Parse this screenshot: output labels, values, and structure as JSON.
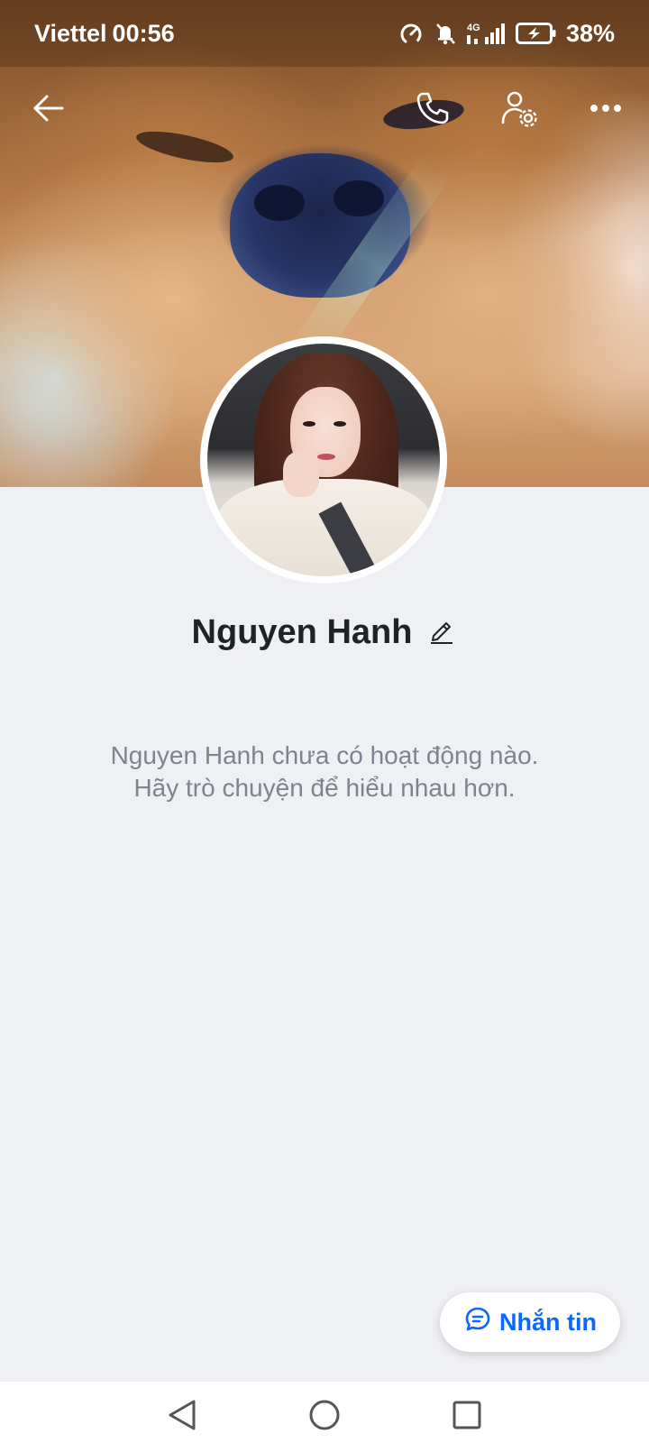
{
  "status_bar": {
    "carrier": "Viettel",
    "time": "00:56",
    "network": "4G",
    "battery": "38%"
  },
  "profile": {
    "name": "Nguyen Hanh",
    "empty_line1": "Nguyen Hanh chưa có hoạt động nào.",
    "empty_line2": "Hãy trò chuyện để hiểu nhau hơn."
  },
  "actions": {
    "message_label": "Nhắn tin"
  },
  "icons": {
    "back": "back-arrow-icon",
    "call": "phone-icon",
    "settings": "user-settings-icon",
    "more": "more-dots-icon",
    "edit": "pencil-icon",
    "message": "chat-bubble-icon"
  },
  "colors": {
    "accent": "#0a68ff",
    "background": "#eff0f4",
    "name_text": "#1f2226",
    "muted_text": "#7d8490"
  }
}
